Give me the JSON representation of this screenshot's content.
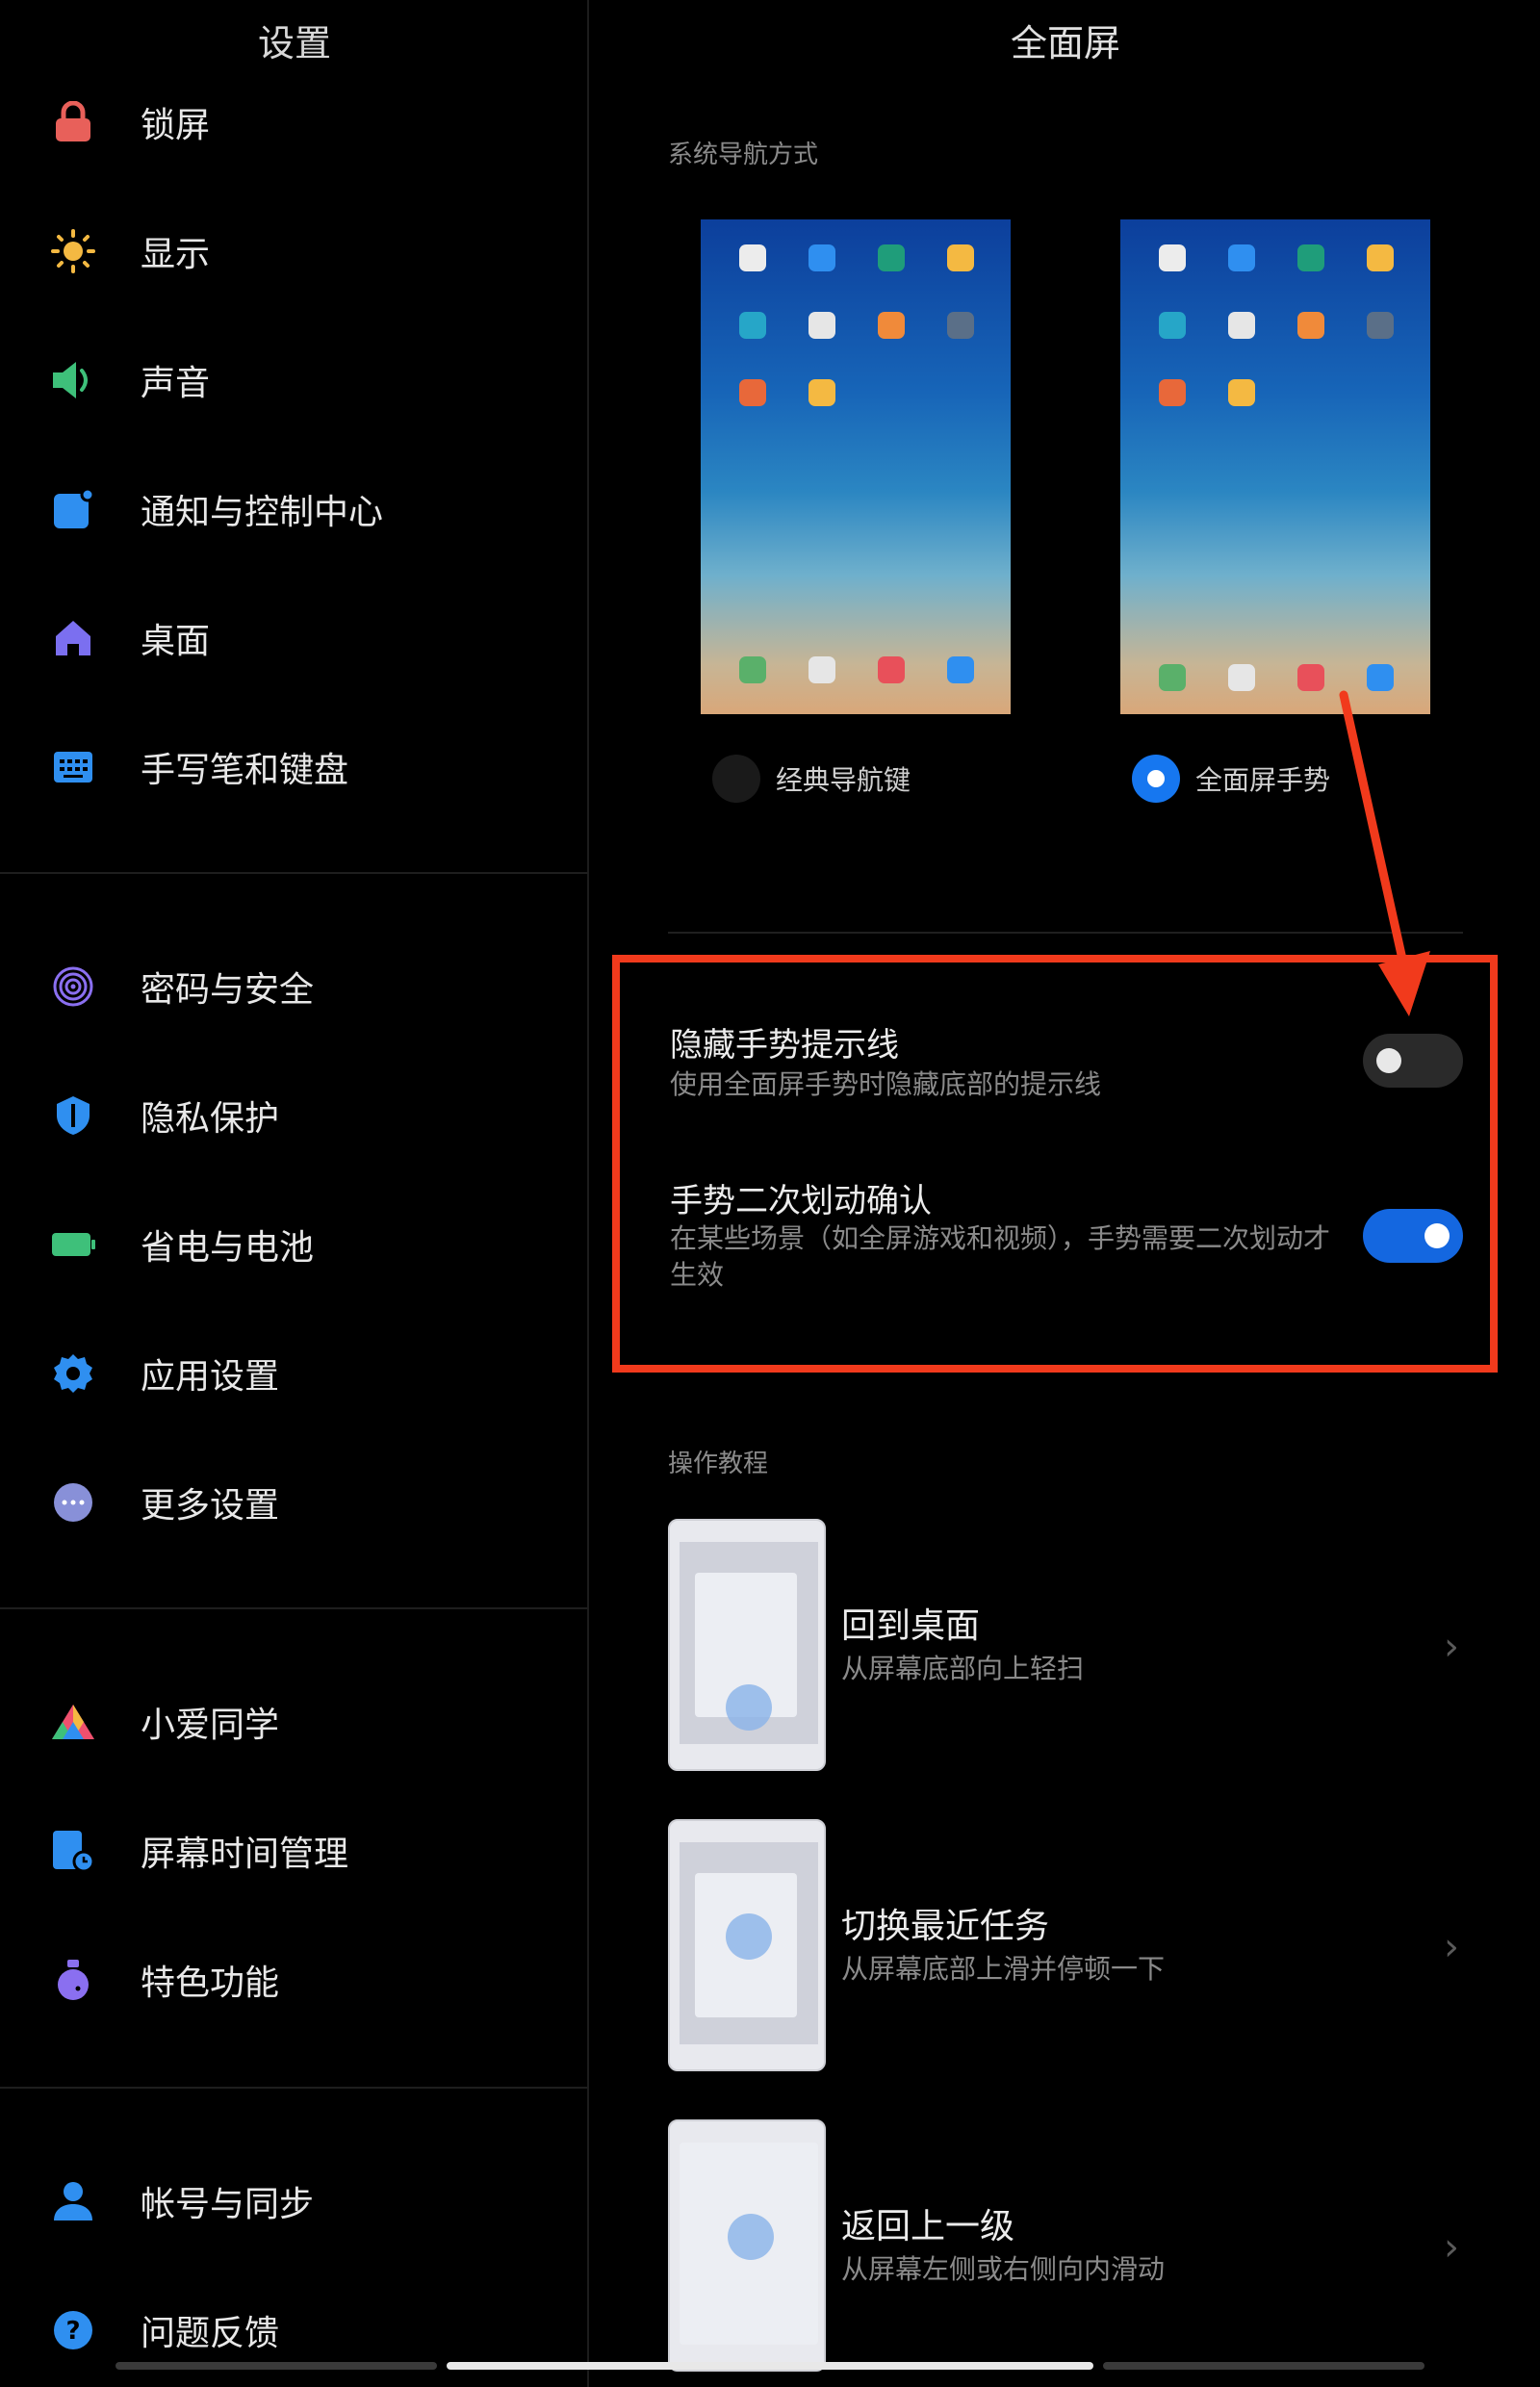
{
  "sidebar": {
    "title": "设置",
    "groups": [
      [
        {
          "label": "锁屏",
          "icon": "lock-icon",
          "color": "#e8605a"
        },
        {
          "label": "显示",
          "icon": "sun-icon",
          "color": "#f4b942"
        },
        {
          "label": "声音",
          "icon": "speaker-icon",
          "color": "#3ec07a"
        },
        {
          "label": "通知与控制中心",
          "icon": "notification-icon",
          "color": "#2f8ff0"
        },
        {
          "label": "桌面",
          "icon": "home-icon",
          "color": "#7b6ff0"
        },
        {
          "label": "手写笔和键盘",
          "icon": "keyboard-icon",
          "color": "#2f8ff0"
        }
      ],
      [
        {
          "label": "密码与安全",
          "icon": "fingerprint-icon",
          "color": "#8a6ff0"
        },
        {
          "label": "隐私保护",
          "icon": "privacy-shield-icon",
          "color": "#2f8ff0"
        },
        {
          "label": "省电与电池",
          "icon": "battery-icon",
          "color": "#3ec07a"
        },
        {
          "label": "应用设置",
          "icon": "gear-icon",
          "color": "#2f8ff0"
        },
        {
          "label": "更多设置",
          "icon": "more-dots-icon",
          "color": "#8890d8"
        }
      ],
      [
        {
          "label": "小爱同学",
          "icon": "xiaoai-icon",
          "color": "#f0506e"
        },
        {
          "label": "屏幕时间管理",
          "icon": "screen-time-icon",
          "color": "#2f8ff0"
        },
        {
          "label": "特色功能",
          "icon": "feature-flask-icon",
          "color": "#8a6ff0"
        }
      ],
      [
        {
          "label": "帐号与同步",
          "icon": "account-icon",
          "color": "#2f8ff0"
        },
        {
          "label": "问题反馈",
          "icon": "help-icon",
          "color": "#2f8ff0"
        }
      ]
    ]
  },
  "main": {
    "title": "全面屏",
    "nav_section_label": "系统导航方式",
    "nav_options": [
      {
        "label": "经典导航键",
        "selected": false
      },
      {
        "label": "全面屏手势",
        "selected": true
      }
    ],
    "settings": [
      {
        "title": "隐藏手势提示线",
        "desc": "使用全面屏手势时隐藏底部的提示线",
        "enabled": false
      },
      {
        "title": "手势二次划动确认",
        "desc": "在某些场景（如全屏游戏和视频），手势需要二次划动才生效",
        "enabled": true
      }
    ],
    "tutorial_section_label": "操作教程",
    "tutorials": [
      {
        "title": "回到桌面",
        "desc": "从屏幕底部向上轻扫"
      },
      {
        "title": "切换最近任务",
        "desc": "从屏幕底部上滑并停顿一下"
      },
      {
        "title": "返回上一级",
        "desc": "从屏幕左侧或右侧向内滑动"
      }
    ]
  },
  "colors": {
    "accent": "#1677f0",
    "highlight": "#f13a1c",
    "background": "#000000"
  }
}
